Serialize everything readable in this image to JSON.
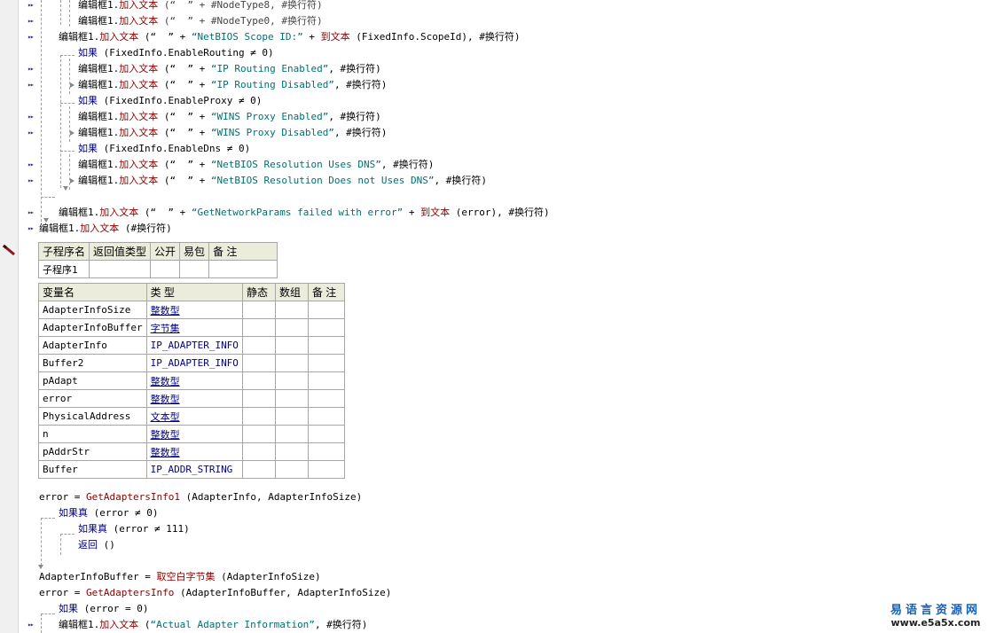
{
  "code": {
    "l1": {
      "obj": "编辑框1.",
      "fn": "加入文本",
      "rest": " (“  ” + #NodeType8, #换行符)"
    },
    "l2": {
      "obj": "编辑框1.",
      "fn": "加入文本",
      "rest": " (“  ” + #NodeType0, #换行符)"
    },
    "l3": {
      "obj": "编辑框1.",
      "fn": "加入文本",
      "a": " (“  ” + ",
      "str": "“NetBIOS Scope ID:”",
      "b": " + ",
      "fn2": "到文本",
      "c": " (FixedInfo.ScopeId), #换行符)"
    },
    "l4": {
      "kw": "如果",
      "rest": " (FixedInfo.EnableRouting ≠ 0)"
    },
    "l5": {
      "obj": "编辑框1.",
      "fn": "加入文本",
      "a": " (“  ” + ",
      "str": "“IP Routing Enabled”",
      "b": ", #换行符)"
    },
    "l6": {
      "obj": "编辑框1.",
      "fn": "加入文本",
      "a": " (“  ” + ",
      "str": "“IP Routing Disabled”",
      "b": ", #换行符)"
    },
    "l7": {
      "kw": "如果",
      "rest": " (FixedInfo.EnableProxy ≠ 0)"
    },
    "l8": {
      "obj": "编辑框1.",
      "fn": "加入文本",
      "a": " (“  ” + ",
      "str": "“WINS Proxy Enabled”",
      "b": ", #换行符)"
    },
    "l9": {
      "obj": "编辑框1.",
      "fn": "加入文本",
      "a": " (“  ” + ",
      "str": "“WINS Proxy Disabled”",
      "b": ", #换行符)"
    },
    "l10": {
      "kw": "如果",
      "rest": " (FixedInfo.EnableDns ≠ 0)"
    },
    "l11": {
      "obj": "编辑框1.",
      "fn": "加入文本",
      "a": " (“  ” + ",
      "str": "“NetBIOS Resolution Uses DNS”",
      "b": ", #换行符)"
    },
    "l12": {
      "obj": "编辑框1.",
      "fn": "加入文本",
      "a": " (“  ” + ",
      "str": "“NetBIOS Resolution Does not Uses DNS”",
      "b": ", #换行符)"
    },
    "l13": {
      "obj": "编辑框1.",
      "fn": "加入文本",
      "a": " (“  ” + ",
      "str": "“GetNetworkParams failed with error”",
      "b": " + ",
      "fn2": "到文本",
      "c": " (error), #换行符)"
    },
    "l14": {
      "obj": "编辑框1.",
      "fn": "加入文本",
      "rest": " (#换行符)"
    },
    "l15": {
      "a": "error = ",
      "fn": "GetAdaptersInfo1",
      "rest": " (AdapterInfo, AdapterInfoSize)"
    },
    "l16": {
      "kw": "如果真",
      "rest": " (error ≠ 0)"
    },
    "l17": {
      "kw": "如果真",
      "rest": " (error ≠ 111)"
    },
    "l18": {
      "kw": "返回",
      "rest": " ()"
    },
    "l19": {
      "a": "AdapterInfoBuffer = ",
      "fn": "取空白字节集",
      "rest": " (AdapterInfoSize)"
    },
    "l20": {
      "a": "error = ",
      "fn": "GetAdaptersInfo",
      "rest": " (AdapterInfoBuffer, AdapterInfoSize)"
    },
    "l21": {
      "kw": "如果",
      "rest": " (error = 0)"
    },
    "l22": {
      "obj": "编辑框1.",
      "fn": "加入文本",
      "a": " (",
      "str": "“Actual Adapter Information”",
      "b": ", #换行符)"
    }
  },
  "sub_table": {
    "headers": [
      "子程序名",
      "返回值类型",
      "公开",
      "易包",
      "备 注"
    ],
    "row": [
      "子程序1",
      "",
      "",
      "",
      ""
    ]
  },
  "var_table": {
    "headers": [
      "变量名",
      "类 型",
      "静态",
      "数组",
      "备 注"
    ],
    "rows": [
      {
        "name": "AdapterInfoSize",
        "type": "整数型"
      },
      {
        "name": "AdapterInfoBuffer",
        "type": "字节集"
      },
      {
        "name": "AdapterInfo",
        "type": "IP_ADAPTER_INFO"
      },
      {
        "name": "Buffer2",
        "type": "IP_ADAPTER_INFO"
      },
      {
        "name": "pAdapt",
        "type": "整数型"
      },
      {
        "name": "error",
        "type": "整数型"
      },
      {
        "name": "PhysicalAddress",
        "type": "文本型"
      },
      {
        "name": "n",
        "type": "整数型"
      },
      {
        "name": "pAddrStr",
        "type": "整数型"
      },
      {
        "name": "Buffer",
        "type": "IP_ADDR_STRING"
      }
    ]
  },
  "watermark": {
    "cn": "易语言资源网",
    "url": "www.e5a5x.com"
  },
  "icons": {
    "breakpoint": "double-chevron-icon",
    "marker": "pencil-icon"
  }
}
